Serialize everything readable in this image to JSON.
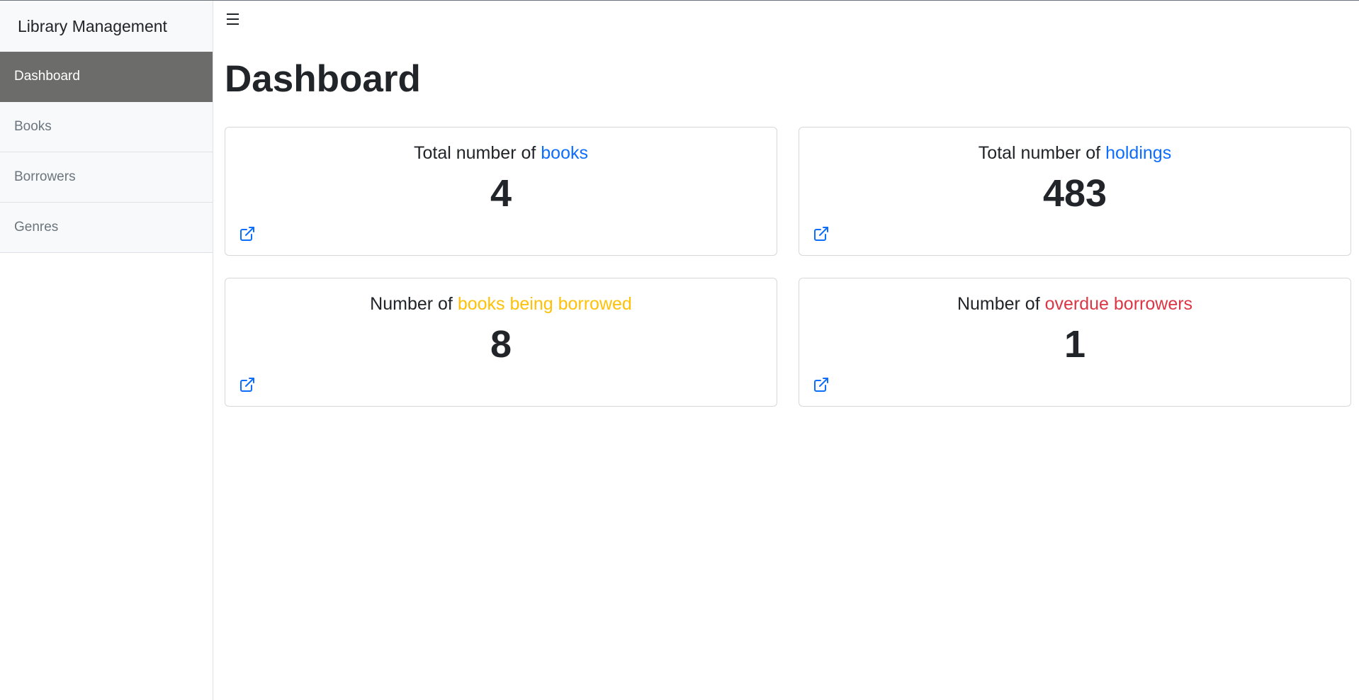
{
  "app": {
    "title": "Library Management"
  },
  "sidebar": {
    "items": [
      {
        "label": "Dashboard",
        "active": true
      },
      {
        "label": "Books",
        "active": false
      },
      {
        "label": "Borrowers",
        "active": false
      },
      {
        "label": "Genres",
        "active": false
      }
    ]
  },
  "toolbar": {
    "menu_icon": "hamburger-icon"
  },
  "page": {
    "title": "Dashboard"
  },
  "cards": [
    {
      "prefix": "Total number of ",
      "highlight": "books",
      "highlight_color": "#0d6efd",
      "value": "4",
      "link_icon": "external-link-icon"
    },
    {
      "prefix": "Total number of ",
      "highlight": "holdings",
      "highlight_color": "#0d6efd",
      "value": "483",
      "link_icon": "external-link-icon"
    },
    {
      "prefix": "Number of ",
      "highlight": "books being borrowed",
      "highlight_color": "#ffc107",
      "value": "8",
      "link_icon": "external-link-icon"
    },
    {
      "prefix": "Number of ",
      "highlight": "overdue borrowers",
      "highlight_color": "#dc3545",
      "value": "1",
      "link_icon": "external-link-icon"
    }
  ],
  "colors": {
    "active_nav": "#6c6d6b",
    "link": "#0d6efd"
  }
}
